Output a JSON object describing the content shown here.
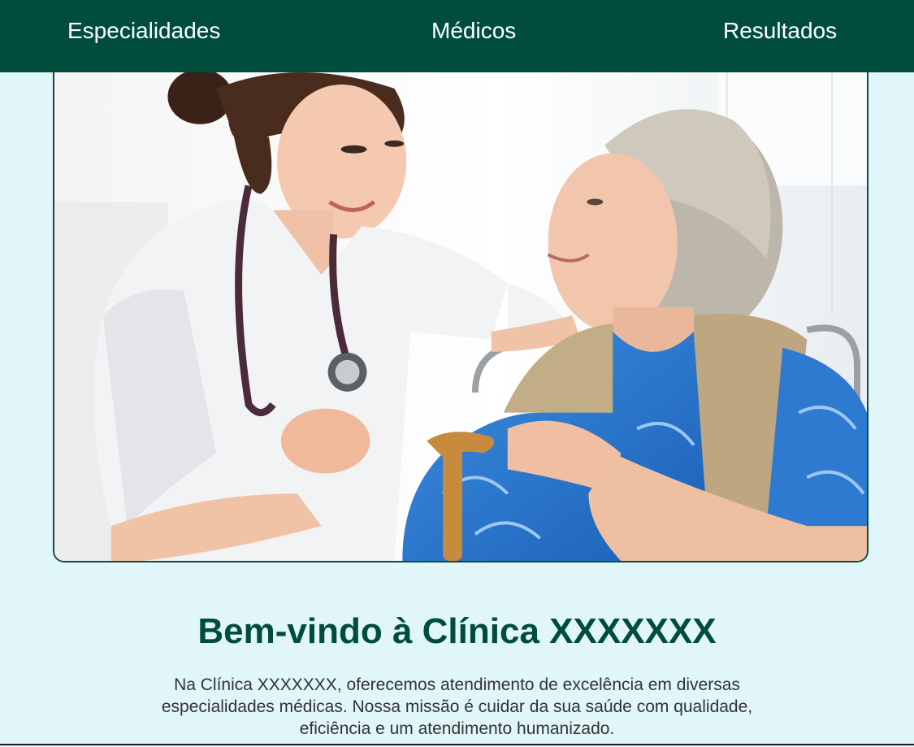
{
  "nav": {
    "items": [
      {
        "label": "Especialidades"
      },
      {
        "label": "Médicos"
      },
      {
        "label": "Resultados"
      }
    ]
  },
  "hero": {
    "image_icon": "nurse-with-elderly-patient-photo"
  },
  "welcome": {
    "title": "Bem-vindo à Clínica XXXXXXX",
    "text": "Na Clínica XXXXXXX, oferecemos atendimento de excelência em diversas especialidades médicas. Nossa missão é cuidar da sua saúde com qualidade, eficiência e um atendimento humanizado."
  },
  "colors": {
    "navbar_bg": "#014d3d",
    "page_bg": "#e0f6f8",
    "title": "#014d3d",
    "body_text": "#333333"
  }
}
